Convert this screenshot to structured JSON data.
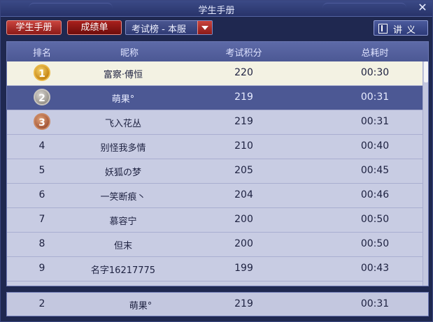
{
  "window": {
    "title": "学生手册",
    "close_glyph": "✕"
  },
  "toolbar": {
    "handbook_label": "学生手册",
    "report_label": "成绩单",
    "ranking_select": "考试榜 - 本服",
    "lecture_label": "讲义"
  },
  "table": {
    "columns": [
      "排名",
      "昵称",
      "考试积分",
      "总耗时"
    ],
    "rows": [
      {
        "rank": "1",
        "name": "富察·傅恒",
        "score": "220",
        "time": "00:30"
      },
      {
        "rank": "2",
        "name": "萌果°",
        "score": "219",
        "time": "00:31"
      },
      {
        "rank": "3",
        "name": "飞入花丛",
        "score": "219",
        "time": "00:31"
      },
      {
        "rank": "4",
        "name": "别怪我多情",
        "score": "210",
        "time": "00:40"
      },
      {
        "rank": "5",
        "name": "妖狐の梦",
        "score": "205",
        "time": "00:45"
      },
      {
        "rank": "6",
        "name": "一笑断痕丶",
        "score": "204",
        "time": "00:46"
      },
      {
        "rank": "7",
        "name": "慕容宁",
        "score": "200",
        "time": "00:50"
      },
      {
        "rank": "8",
        "name": "但末",
        "score": "200",
        "time": "00:50"
      },
      {
        "rank": "9",
        "name": "名字16217775",
        "score": "199",
        "time": "00:43"
      }
    ],
    "selected_rank": "2"
  },
  "my_rank": {
    "rank": "2",
    "name": "萌果°",
    "score": "219",
    "time": "00:31"
  },
  "colors": {
    "frame": "#1f2850",
    "header": "#4c5894",
    "row": "#c8cce3",
    "first_row": "#f3f2e3",
    "selected_row": "#4c5894",
    "button_red": "#a8201c"
  }
}
